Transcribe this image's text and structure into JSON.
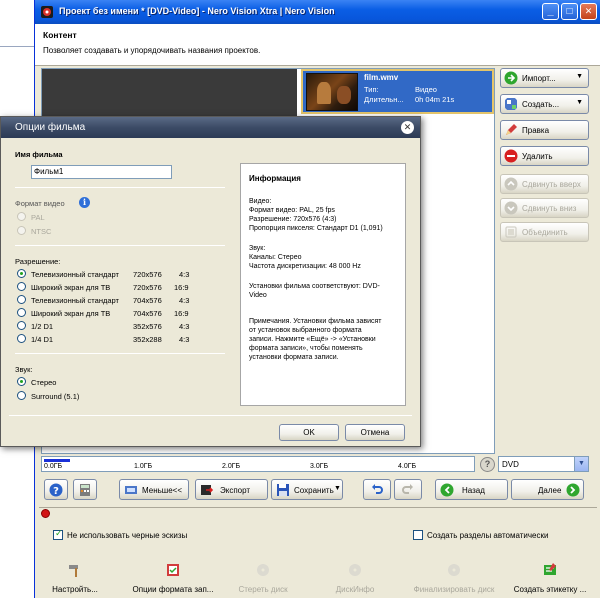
{
  "window": {
    "title": "Проект без имени * [DVD-Video] - Nero Vision Xtra | Nero Vision",
    "minimize": "_",
    "maximize": "□",
    "close": "✕"
  },
  "header": {
    "title": "Контент",
    "subtitle": "Позволяет создавать и упорядочивать названия проектов."
  },
  "film_item": {
    "name": "film.wmv",
    "type_label": "Тип:",
    "type_value": "Видео",
    "duration_label": "Длительн...",
    "duration_value": "0h 04m 21s"
  },
  "side_buttons": {
    "import": "Импорт...",
    "create": "Создать...",
    "edit": "Правка",
    "delete": "Удалить",
    "move_up": "Сдвинуть вверх",
    "move_down": "Сдвинуть вниз",
    "merge": "Объединить"
  },
  "capacity": {
    "used_fraction": 0.06,
    "ticks": [
      "1.0ГБ",
      "2.0ГБ",
      "3.0ГБ",
      "4.0ГБ"
    ],
    "start": "0.0ГБ",
    "disc_type": "DVD",
    "help": "?"
  },
  "toolbar": {
    "less": "Меньше<<",
    "export": "Экспорт",
    "save": "Сохранить",
    "back": "Назад",
    "next": "Далее"
  },
  "options": {
    "no_black_thumbs": "Не использовать черные эскизы",
    "auto_chapters": "Создать разделы автоматически"
  },
  "footer": {
    "settings": "Настройть...",
    "format_options": "Опции формата зап...",
    "erase_disc": "Стереть диск",
    "disc_info": "ДискИнфо",
    "finalize_disc": "Финализировать диск",
    "create_label": "Создать этикетку ..."
  },
  "dialog": {
    "title": "Опции фильма",
    "film_name_label": "Имя фильма",
    "film_name_value": "Фильм1",
    "video_format_label": "Формат видео",
    "format_pal": "PAL",
    "format_ntsc": "NTSC",
    "resolution_label": "Разрешение:",
    "resolutions": [
      {
        "name": "Телевизионный стандарт",
        "res": "720x576",
        "ratio": "4:3",
        "selected": true
      },
      {
        "name": "Широкий экран для ТВ",
        "res": "720x576",
        "ratio": "16:9",
        "selected": false
      },
      {
        "name": "Телевизионный стандарт",
        "res": "704x576",
        "ratio": "4:3",
        "selected": false
      },
      {
        "name": "Широкий экран для ТВ",
        "res": "704x576",
        "ratio": "16:9",
        "selected": false
      },
      {
        "name": "1/2 D1",
        "res": "352x576",
        "ratio": "4:3",
        "selected": false
      },
      {
        "name": "1/4 D1",
        "res": "352x288",
        "ratio": "4:3",
        "selected": false
      }
    ],
    "sound_label": "Звук:",
    "sound_stereo": "Стерео",
    "sound_surround": "Surround (5.1)",
    "info": {
      "title": "Информация",
      "video_head": "Видео:",
      "video_format": "Формат видео: PAL, 25 fps",
      "video_resolution": "Разрешение: 720x576 (4:3)",
      "video_pixel": "Пропорция пикселя: Стандарт D1 (1,091)",
      "audio_head": "Звук:",
      "audio_channels": "Каналы: Стерео",
      "audio_rate": "Частота дискретизации: 48 000 Hz",
      "conform_1": "Установки фильма соответствуют: DVD-",
      "conform_2": "Video",
      "note_1": "Примечания. Установки фильма зависят",
      "note_2": "от установок выбранного формата",
      "note_3": "записи. Нажмите «Ещё» -> «Установки",
      "note_4": "формата записи», чтобы поменять",
      "note_5": "установки формата записи."
    },
    "ok": "OK",
    "cancel": "Отмена",
    "close": "✕"
  }
}
